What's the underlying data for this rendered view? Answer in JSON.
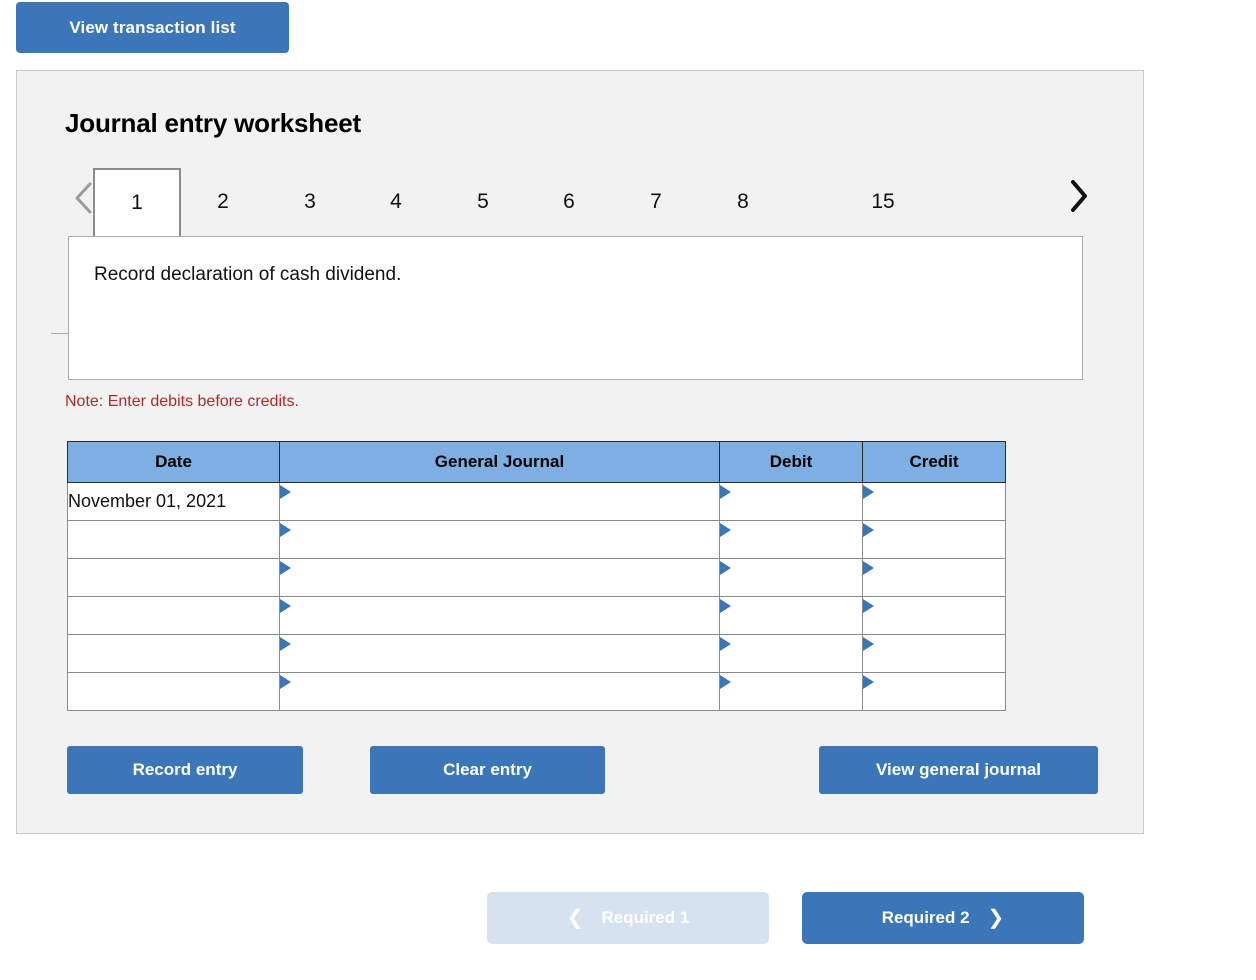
{
  "toolbar": {
    "view_transaction_list_label": "View transaction list"
  },
  "worksheet": {
    "title": "Journal entry worksheet",
    "prev_icon": "chevron-left-icon",
    "next_icon": "chevron-right-icon",
    "tabs": [
      {
        "label": "1",
        "active": true
      },
      {
        "label": "2",
        "active": false
      },
      {
        "label": "3",
        "active": false
      },
      {
        "label": "4",
        "active": false
      },
      {
        "label": "5",
        "active": false
      },
      {
        "label": "6",
        "active": false
      },
      {
        "label": "7",
        "active": false
      },
      {
        "label": "8",
        "active": false
      },
      {
        "label": "15",
        "active": false
      }
    ],
    "description": "Record declaration of cash dividend.",
    "note": "Note: Enter debits before credits.",
    "table": {
      "columns": [
        "Date",
        "General Journal",
        "Debit",
        "Credit"
      ],
      "rows": [
        {
          "date": "November 01, 2021",
          "general_journal": "",
          "debit": "",
          "credit": ""
        },
        {
          "date": "",
          "general_journal": "",
          "debit": "",
          "credit": ""
        },
        {
          "date": "",
          "general_journal": "",
          "debit": "",
          "credit": ""
        },
        {
          "date": "",
          "general_journal": "",
          "debit": "",
          "credit": ""
        },
        {
          "date": "",
          "general_journal": "",
          "debit": "",
          "credit": ""
        },
        {
          "date": "",
          "general_journal": "",
          "debit": "",
          "credit": ""
        }
      ]
    },
    "actions": {
      "record_entry_label": "Record entry",
      "clear_entry_label": "Clear entry",
      "view_general_journal_label": "View general journal"
    }
  },
  "footer": {
    "prev_label": "Required 1",
    "prev_icon": "chevron-left-icon",
    "prev_disabled": true,
    "next_label": "Required 2",
    "next_icon": "chevron-right-icon"
  },
  "colors": {
    "primary_blue": "#3a76b8",
    "header_blue": "#7eafe3",
    "disabled_blue": "#d6e2f0",
    "panel_bg": "#f2f2f2",
    "panel_border": "#c9c9c9",
    "note_red": "#b02a2a",
    "marker_blue": "#3a76b8"
  }
}
